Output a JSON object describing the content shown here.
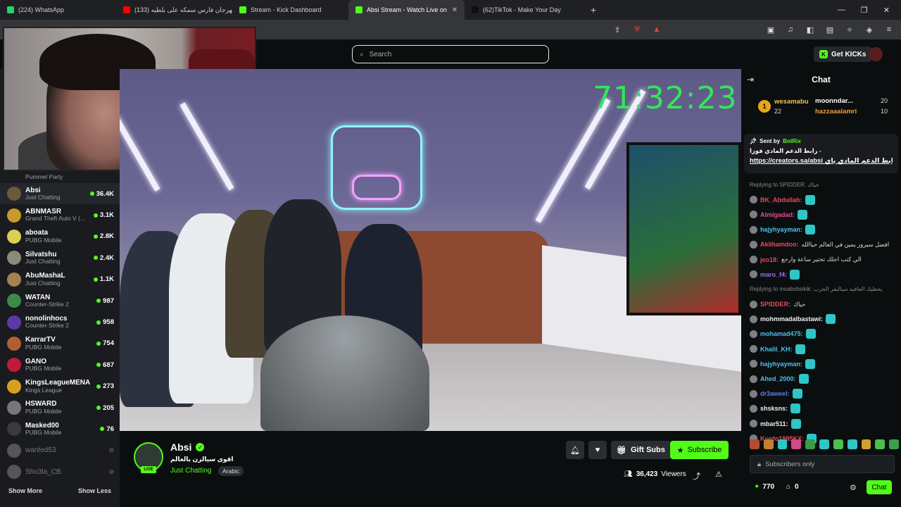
{
  "browser": {
    "tabs": [
      {
        "title": "(224) WhatsApp",
        "color": "#25d366",
        "active": false
      },
      {
        "title": "(133) مهرجان فارس سمكه على بلطيه",
        "color": "#ff0000",
        "active": false
      },
      {
        "title": "Stream - Kick Dashboard",
        "color": "#53fc18",
        "active": false
      },
      {
        "title": "Absi Stream - Watch Live on",
        "color": "#53fc18",
        "active": true
      },
      {
        "title": "(62)TikTok - Make Your Day",
        "color": "#111111",
        "active": false
      }
    ],
    "new_tab": "+",
    "window_controls": [
      "—",
      "❐",
      "✕"
    ]
  },
  "header": {
    "search_placeholder": "Search",
    "get_kicks": "Get KICKs",
    "get_kicks_icon": "K"
  },
  "sidebar": {
    "top_category": "Pummel Party",
    "channels": [
      {
        "name": "Absi",
        "category": "Just Chatting",
        "viewers": "36.4K",
        "color": "#6b5a3a",
        "live": true
      },
      {
        "name": "ABNMASR",
        "category": "Grand Theft Auto V (...",
        "viewers": "3.1K",
        "color": "#c79a2a",
        "live": true
      },
      {
        "name": "aboata",
        "category": "PUBG Mobile",
        "viewers": "2.8K",
        "color": "#d8d050",
        "live": true
      },
      {
        "name": "Silvatshu",
        "category": "Just Chatting",
        "viewers": "2.4K",
        "color": "#8a8a7a",
        "live": true
      },
      {
        "name": "AbuMashaL",
        "category": "Just Chatting",
        "viewers": "1.1K",
        "color": "#a58050",
        "live": true
      },
      {
        "name": "WATAN",
        "category": "Counter-Strike 2",
        "viewers": "987",
        "color": "#3a8a4a",
        "live": true
      },
      {
        "name": "nonolinhocs",
        "category": "Counter-Strike 2",
        "viewers": "958",
        "color": "#5a3aa8",
        "live": true
      },
      {
        "name": "KarrarTV",
        "category": "PUBG Mobile",
        "viewers": "754",
        "color": "#b06030",
        "live": true
      },
      {
        "name": "GANO",
        "category": "PUBG Mobile",
        "viewers": "687",
        "color": "#c01a3a",
        "live": true
      },
      {
        "name": "KingsLeagueMENA",
        "category": "Kings League",
        "viewers": "273",
        "color": "#d4a020",
        "live": true
      },
      {
        "name": "HSWARD",
        "category": "PUBG Mobile",
        "viewers": "205",
        "color": "#777777",
        "live": true
      },
      {
        "name": "Masked00",
        "category": "PUBG Mobile",
        "viewers": "76",
        "color": "#3a3a3a",
        "live": true
      },
      {
        "name": "wanted53",
        "category": "",
        "viewers": "",
        "color": "#555555",
        "live": false
      },
      {
        "name": "Sho3la_CB",
        "category": "",
        "viewers": "",
        "color": "#555555",
        "live": false
      }
    ],
    "show_more": "Show More",
    "show_less": "Show Less"
  },
  "video": {
    "timer": "71:32:23"
  },
  "stream": {
    "name": "Absi",
    "title": "اقوى سيالزن بالعالم",
    "category": "Just Chatting",
    "language": "Arabic",
    "live_label": "LIVE",
    "gift_subs": "Gift Subs",
    "subscribe": "Subscribe",
    "viewers_count": "36,423",
    "viewers_label": "Viewers"
  },
  "chat": {
    "header": "Chat",
    "leaderboard": {
      "first_rank": "1",
      "first_name": "wesamabu",
      "first_count": "22",
      "second_name": "moonndar...",
      "second_count": "20",
      "third_name": "hazzaaalamri",
      "third_count": "10"
    },
    "pinned": {
      "sent_by_label": "Sent by",
      "bot_name": "BotRix",
      "message": "رابط الدعم المادي فوزا -",
      "link": "https://creators.sa/absi رابط الدعم المادي باي..."
    },
    "messages": [
      {
        "type": "reply",
        "user": "",
        "text": "Replying to SPIDDER: حياك",
        "color": "#888888"
      },
      {
        "type": "msg",
        "user": "BK_Abdullah:",
        "text": "",
        "color": "#e84a5f"
      },
      {
        "type": "msg",
        "user": "Almigadad:",
        "text": "",
        "color": "#e84a8a"
      },
      {
        "type": "msg",
        "user": "hajyhyayman:",
        "text": "",
        "color": "#4fc0e8"
      },
      {
        "type": "msg",
        "user": "Akilhamdoo:",
        "text": "افضل سيرور يمين في العالم حياالله",
        "color": "#e84a5f"
      },
      {
        "type": "msg",
        "user": "jeo18:",
        "text": "الي كتب اجلك تحتير ساعة وارجع",
        "color": "#e84a5f"
      },
      {
        "type": "msg",
        "user": "maro_f4:",
        "text": "",
        "color": "#a070f0"
      },
      {
        "type": "reply",
        "user": "",
        "text": "Replying to moabxbsikik: يحطيك العافيه سياليفر الحرب",
        "color": "#888888"
      },
      {
        "type": "msg",
        "user": "SPIDDER:",
        "text": "حياك",
        "color": "#e84a5f"
      },
      {
        "type": "msg",
        "user": "mohmmadalbastawi:",
        "text": "",
        "color": "#f0f0f0"
      },
      {
        "type": "msg",
        "user": "mohamad475:",
        "text": "",
        "color": "#4fc0e8"
      },
      {
        "type": "msg",
        "user": "Khalil_KH:",
        "text": "",
        "color": "#4fc0e8"
      },
      {
        "type": "msg",
        "user": "hajyhyayman:",
        "text": "",
        "color": "#4fc0e8"
      },
      {
        "type": "msg",
        "user": "Ahed_2000:",
        "text": "",
        "color": "#4fc0e8"
      },
      {
        "type": "msg",
        "user": "dr3aweel:",
        "text": "",
        "color": "#5a7af0"
      },
      {
        "type": "msg",
        "user": "shsksns:",
        "text": "",
        "color": "#f0f0f0"
      },
      {
        "type": "msg",
        "user": "mbar511:",
        "text": "",
        "color": "#f0f0f0"
      },
      {
        "type": "msg",
        "user": "Kurdo1985KX:",
        "text": "",
        "color": "#e84a5f"
      }
    ],
    "input_placeholder": "Subscribers only",
    "points": "770",
    "crowns": "0",
    "chat_button": "Chat"
  }
}
